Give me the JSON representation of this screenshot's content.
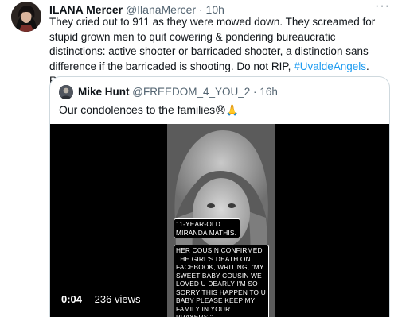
{
  "tweet": {
    "author_name": "ILANA Mercer",
    "author_handle": "@IlanaMercer",
    "separator": "·",
    "time": "10h",
    "more_label": "···",
    "text_part1": "They cried out to 911 as they were mowed down. They screamed for stupid grown men to quit cowering & pondering bureaucratic distinctions: active shooter or barricaded shooter, a distinction sans difference if the barricaded is shooting. Do not RIP, ",
    "hashtag": "#UvaldeAngels",
    "text_part2": ". Rage from heaven"
  },
  "quote": {
    "author_name": "Mike Hunt",
    "author_handle": "@FREEDOM_4_YOU_2",
    "separator": "·",
    "time": "16h",
    "text": "Our condolences to the families",
    "emojis": "😞🙏",
    "video": {
      "duration": "0:04",
      "views": "236 views",
      "caption_1": "11-YEAR-OLD MIRANDA MATHIS.",
      "caption_2": "HER COUSIN CONFIRMED THE GIRL'S DEATH ON FACEBOOK, WRITING, \"MY SWEET BABY COUSIN WE LOVED U DEARLY I'M SO SORRY THIS HAPPEN TO U BABY PLEASE KEEP MY FAMILY IN YOUR PRAYERS.\""
    }
  },
  "colors": {
    "link": "#1d9bf0",
    "secondary_text": "#536471",
    "border": "#cfd9de"
  }
}
